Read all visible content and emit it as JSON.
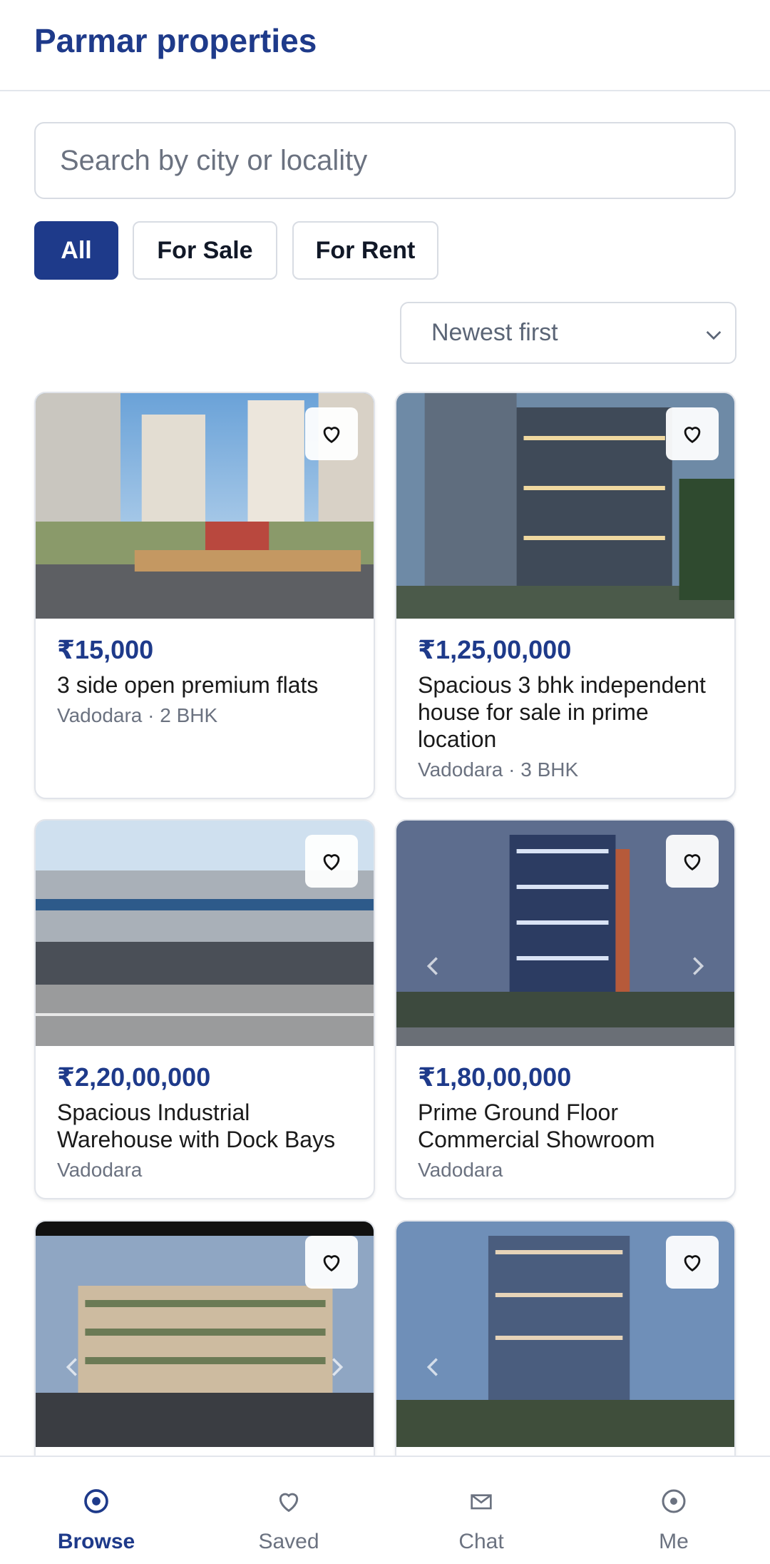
{
  "header": {
    "title": "Parmar properties"
  },
  "search": {
    "placeholder": "Search by city or locality"
  },
  "filters": {
    "all": "All",
    "for_sale": "For Sale",
    "for_rent": "For Rent"
  },
  "sort": {
    "label": "Newest first"
  },
  "listings": [
    {
      "price": "₹15,000",
      "title": "3 side open premium flats",
      "meta": "Vadodara · 2 BHK"
    },
    {
      "price": "₹1,25,00,000",
      "title": "Spacious 3 bhk independent house for sale in prime location",
      "meta": "Vadodara · 3 BHK"
    },
    {
      "price": "₹2,20,00,000",
      "title": "Spacious Industrial Warehouse with Dock Bays",
      "meta": "Vadodara"
    },
    {
      "price": "₹1,80,00,000",
      "title": "Prime Ground Floor Commercial Showroom",
      "meta": "Vadodara"
    }
  ],
  "bottom_nav": {
    "browse": "Browse",
    "saved": "Saved",
    "chat": "Chat",
    "me": "Me"
  },
  "colors": {
    "primary": "#1e3a8a",
    "muted": "#6b7280",
    "border": "#d8dce3"
  },
  "icons": [
    "heart-icon",
    "chevron-down-icon",
    "browse-icon",
    "chat-icon",
    "profile-icon",
    "chevron-left-icon",
    "chevron-right-icon"
  ]
}
